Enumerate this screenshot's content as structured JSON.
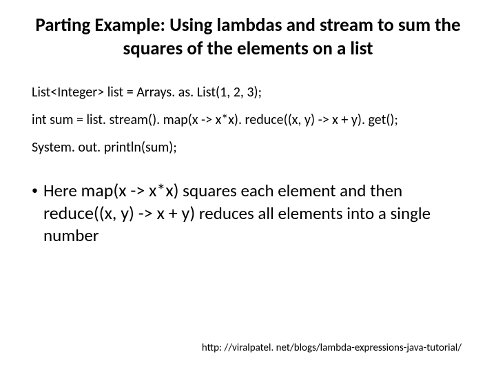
{
  "title": "Parting Example: Using lambdas and stream to sum the squares of the elements on a list",
  "code": {
    "line1": "List<Integer> list = Arrays. as. List(1, 2, 3);",
    "line2": "int sum = list. stream(). map(x -> x*x). reduce((x, y) -> x + y). get();",
    "line3": "System. out. println(sum);"
  },
  "bullet": {
    "prefix": "Here ",
    "code1": "map(x -> x*x)",
    "mid1": " squares each element and then ",
    "code2": "reduce((x, y) -> x + y)",
    "suffix": " reduces all elements into a single number"
  },
  "footer_url": "http: //viralpatel. net/blogs/lambda-expressions-java-tutorial/"
}
